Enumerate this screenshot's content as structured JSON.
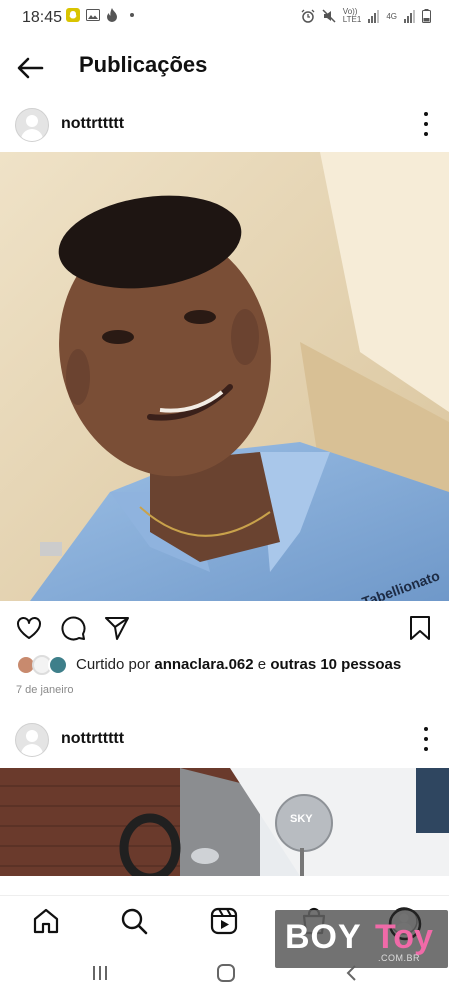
{
  "status_bar": {
    "time": "18:45",
    "network_label_top": "Vo))",
    "network_label_bottom": "LTE1",
    "network2_label": "4G"
  },
  "header": {
    "title": "Publicações"
  },
  "posts": [
    {
      "username": "nottrttttt",
      "likes_prefix": "Curtido por ",
      "liked_by": "annaclara.062",
      "likes_joiner": " e ",
      "likes_others": "outras 10 pessoas",
      "date": "7 de janeiro"
    },
    {
      "username": "nottrttttt"
    }
  ],
  "photo_text": {
    "shirt_text": "Tabellionato",
    "dish_text": "SKY"
  },
  "watermark": {
    "part1": "BOY",
    "part2": "Toy",
    "domain": ".COM.BR"
  },
  "colors": {
    "accent_pink": "#f06aa8",
    "icon_dark": "#111111"
  },
  "icons": {
    "back": "arrow-left-icon",
    "more": "more-vertical-icon",
    "like": "heart-icon",
    "comment": "comment-icon",
    "share": "send-icon",
    "save": "bookmark-icon",
    "home": "home-icon",
    "search": "search-icon",
    "reels": "reels-icon",
    "shop": "shop-icon",
    "profile": "profile-icon"
  }
}
